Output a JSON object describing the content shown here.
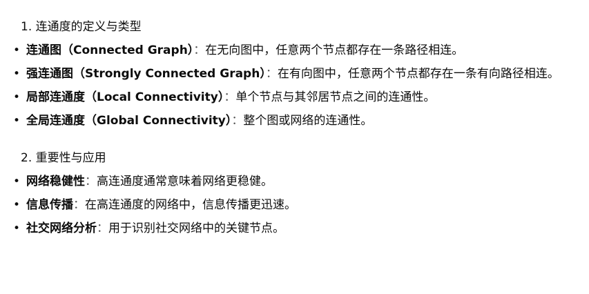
{
  "sections": [
    {
      "heading": "1. 连通度的定义与类型",
      "items": [
        {
          "term": "连通图（Connected Graph）",
          "sep": "：",
          "desc": "在无向图中，任意两个节点都存在一条路径相连。"
        },
        {
          "term": "强连通图（Strongly Connected Graph）",
          "sep": "：",
          "desc": "在有向图中，任意两个节点都存在一条有向路径相连。"
        },
        {
          "term": "局部连通度（Local Connectivity）",
          "sep": "：",
          "desc": "单个节点与其邻居节点之间的连通性。"
        },
        {
          "term": "全局连通度（Global Connectivity）",
          "sep": "：",
          "desc": "整个图或网络的连通性。"
        }
      ]
    },
    {
      "heading": "2. 重要性与应用",
      "items": [
        {
          "term": "网络稳健性",
          "sep": "：",
          "desc": "高连通度通常意味着网络更稳健。"
        },
        {
          "term": "信息传播",
          "sep": "：",
          "desc": "在高连通度的网络中，信息传播更迅速。"
        },
        {
          "term": "社交网络分析",
          "sep": "：",
          "desc": "用于识别社交网络中的关键节点。"
        }
      ]
    }
  ],
  "bullet_glyph": "•"
}
